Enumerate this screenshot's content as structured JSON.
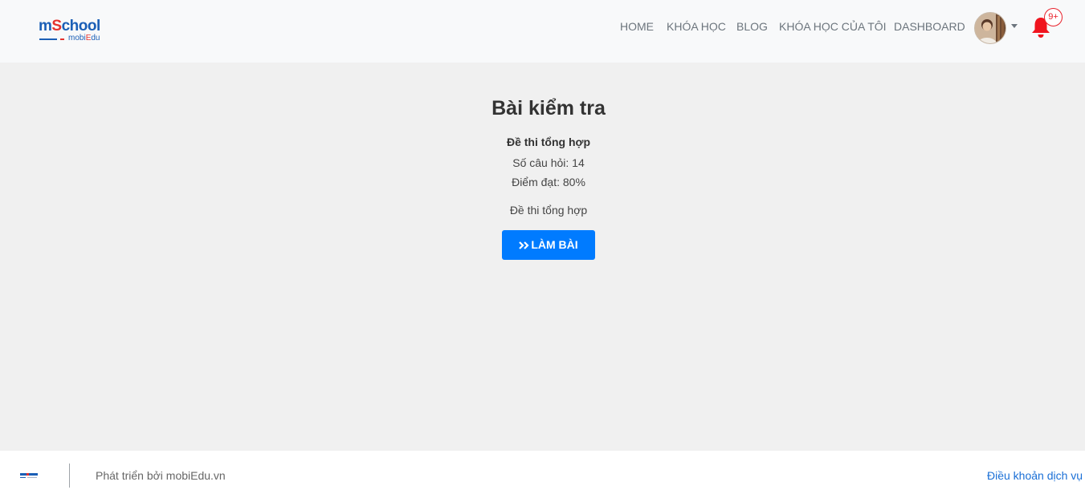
{
  "header": {
    "logo": {
      "main_a": "m",
      "main_b": "S",
      "main_c": "chool",
      "sub_a": "mobi",
      "sub_b": "E",
      "sub_c": "du"
    },
    "nav": {
      "home": "HOME",
      "courses": "KHÓA HỌC",
      "blog": "BLOG",
      "my_courses": "KHÓA HỌC CỦA TÔI",
      "dashboard": "DASHBOARD"
    },
    "avatar_icon": "user-avatar",
    "menu_caret_icon": "caret-down-icon",
    "notification_icon": "bell-icon",
    "notification_badge": "9+"
  },
  "main": {
    "title": "Bài kiểm tra",
    "exam_name": "Đề thi tổng hợp",
    "question_count": "Số câu hỏi: 14",
    "pass_score": "Điểm đạt: 80%",
    "description": "Đề thi tổng hợp",
    "start_button": {
      "icon": "double-chevron-right-icon",
      "label": "LÀM BÀI"
    }
  },
  "footer": {
    "developed_by": "Phát triển bởi mobiEdu.vn",
    "terms_link": "Điều khoản dịch vụ"
  },
  "colors": {
    "nav_bg": "#f8f9fa",
    "page_bg": "#f0f0f0",
    "primary": "#007bff",
    "notification_red": "#e8202a",
    "logo_blue": "#1b5fb6",
    "logo_red": "#e5322d",
    "link_blue": "#1a6fd6"
  }
}
